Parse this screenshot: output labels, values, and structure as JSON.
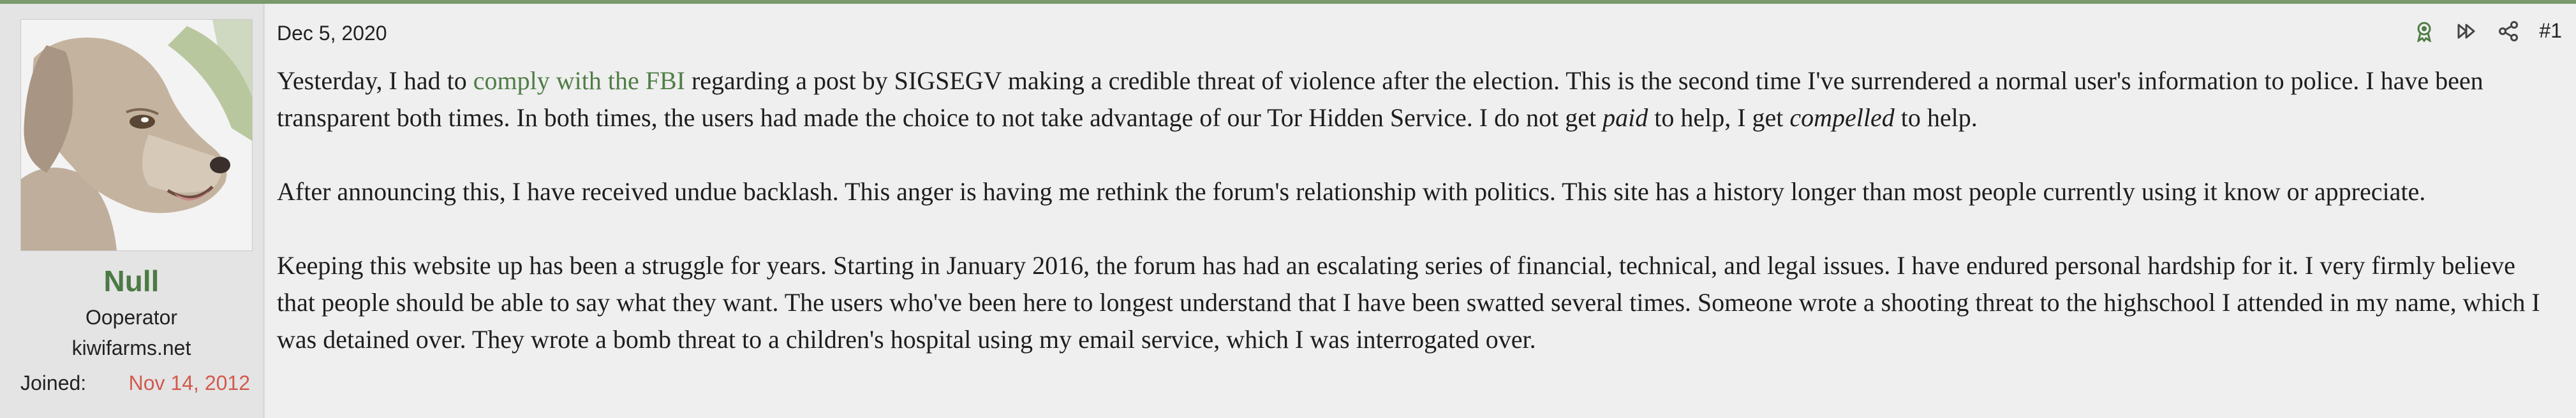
{
  "user": {
    "name": "Null",
    "title": "Ooperator",
    "banner": "kiwifarms.net",
    "joined_label": "Joined:",
    "joined_date": "Nov 14, 2012"
  },
  "post": {
    "date": "Dec 5, 2020",
    "number": "#1",
    "paragraphs": [
      {
        "before_link": "Yesterday, I had to ",
        "link": "comply with the FBI",
        "after_link": " regarding a post by SIGSEGV making a credible threat of violence after the election. This is the second time I've surrendered a normal user's information to police. I have been transparent both times. In both times, the users had made the choice to not take advantage of our Tor Hidden Service. I do not get ",
        "em1": "paid",
        "mid": " to help, I get ",
        "em2": "compelled",
        "end": " to help."
      },
      {
        "text": "After announcing this, I have received undue backlash. This anger is having me rethink the forum's relationship with politics. This site has a history longer than most people currently using it know or appreciate."
      },
      {
        "text": "Keeping this website up has been a struggle for years. Starting in January 2016, the forum has had an escalating series of financial, technical, and legal issues. I have endured personal hardship for it. I very firmly believe that people should be able to say what they want. The users who've been here to longest understand that I have been swatted several times. Someone wrote a shooting threat to the highschool I attended in my name, which I was detained over. They wrote a bomb threat to a children's hospital using my email service, which I was interrogated over."
      }
    ]
  },
  "icons": {
    "bookmark": "ribbon-icon",
    "forward": "fast-forward-icon",
    "share": "share-icon"
  },
  "colors": {
    "username": "#4c7a45",
    "link": "#4f7d46",
    "joined_date": "#d25a4e",
    "top_border": "#7a9a6e"
  }
}
